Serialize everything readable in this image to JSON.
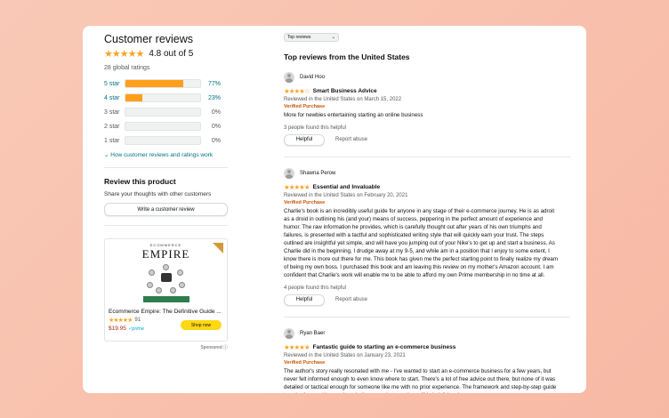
{
  "summary": {
    "title": "Customer reviews",
    "stars": "★★★★★",
    "average": "4.8 out of 5",
    "global_ratings": "28 global ratings",
    "histogram": [
      {
        "label": "5 star",
        "percent": 77,
        "percent_text": "77%",
        "link": true
      },
      {
        "label": "4 star",
        "percent": 23,
        "percent_text": "23%",
        "link": true
      },
      {
        "label": "3 star",
        "percent": 0,
        "percent_text": "0%",
        "link": false
      },
      {
        "label": "2 star",
        "percent": 0,
        "percent_text": "0%",
        "link": false
      },
      {
        "label": "1 star",
        "percent": 0,
        "percent_text": "0%",
        "link": false
      }
    ],
    "how_link": "⌄ How customer reviews and ratings work"
  },
  "review_product": {
    "title": "Review this product",
    "subtitle": "Share your thoughts with other customers",
    "button": "Write a customer review"
  },
  "ad": {
    "cover_small": "ECOMMERCE",
    "cover_title": "EMPIRE",
    "title": "Ecommerce Empire: The Definitive Guide ...",
    "stars": "★★★★★",
    "rating_count": "91",
    "price": "$19.95",
    "prime": "✓prime",
    "shop_button": "Shop now",
    "sponsored": "Sponsored ⓘ"
  },
  "sort": {
    "value": "Top reviews"
  },
  "reviews_heading": "Top reviews from the United States",
  "reviews": [
    {
      "name": "David Hoo",
      "stars": "★★★★☆",
      "headline": "Smart Business Advice",
      "date": "Reviewed in the United States on March 15, 2022",
      "verified": "Verified Purchase",
      "body": "More for newbies entertaining starting an online business",
      "helpful_count": "3 people found this helpful",
      "helpful_btn": "Helpful",
      "report": "Report abuse"
    },
    {
      "name": "Shawna Perow",
      "stars": "★★★★★",
      "headline": "Essential and Invaluable",
      "date": "Reviewed in the United States on February 20, 2021",
      "verified": "Verified Purchase",
      "body": "Charlie's book is an incredibly useful guide for anyone in any stage of their e-commerce journey. He is as adroit as a droid in outlining his (and your) means of success, peppering in the perfect amount of experience and humor. The raw information he provides, which is carefully thought out after years of his own triumphs and failures, is presented with a tactful and sophisticated writing style that will quickly earn your trust. The steps outlined are insightful yet simple, and will have you jumping out of your Nike's to get up and start a business. As Charlie did in the beginning, I drudge away at my 9-5, and while am in a position that I enjoy to some extent, I know there is more out there for me. This book has given me the perfect starting point to finally realize my dream of being my own boss. I purchased this book and am leaving this review on my mother's Amazon account. I am confident that Charlie's work will enable me to be able to afford my own Prime membership in no time at all.",
      "helpful_count": "4 people found this helpful",
      "helpful_btn": "Helpful",
      "report": "Report abuse"
    },
    {
      "name": "Ryan Baer",
      "stars": "★★★★★",
      "headline": "Fantastic guide to starting an e-commerce business",
      "date": "Reviewed in the United States on January 23, 2021",
      "verified": "Verified Purchase",
      "body": "The author's story really resonated with me - I've wanted to start an e-commerce business for a few years, but never felt informed enough to even know where to start. There's a lot of free advice out there, but none of it was detailed or tactical enough for someone like me with no prior experience. The framework and step-by-step guide to selecting, making, and marketing a product was incredibly helpful and",
      "helpful_count": "",
      "helpful_btn": "",
      "report": ""
    }
  ],
  "colors": {
    "star": "#f5a623",
    "bar": "#ff9f1a",
    "link": "#007185",
    "verified": "#c45500",
    "button": "#ffd814"
  }
}
